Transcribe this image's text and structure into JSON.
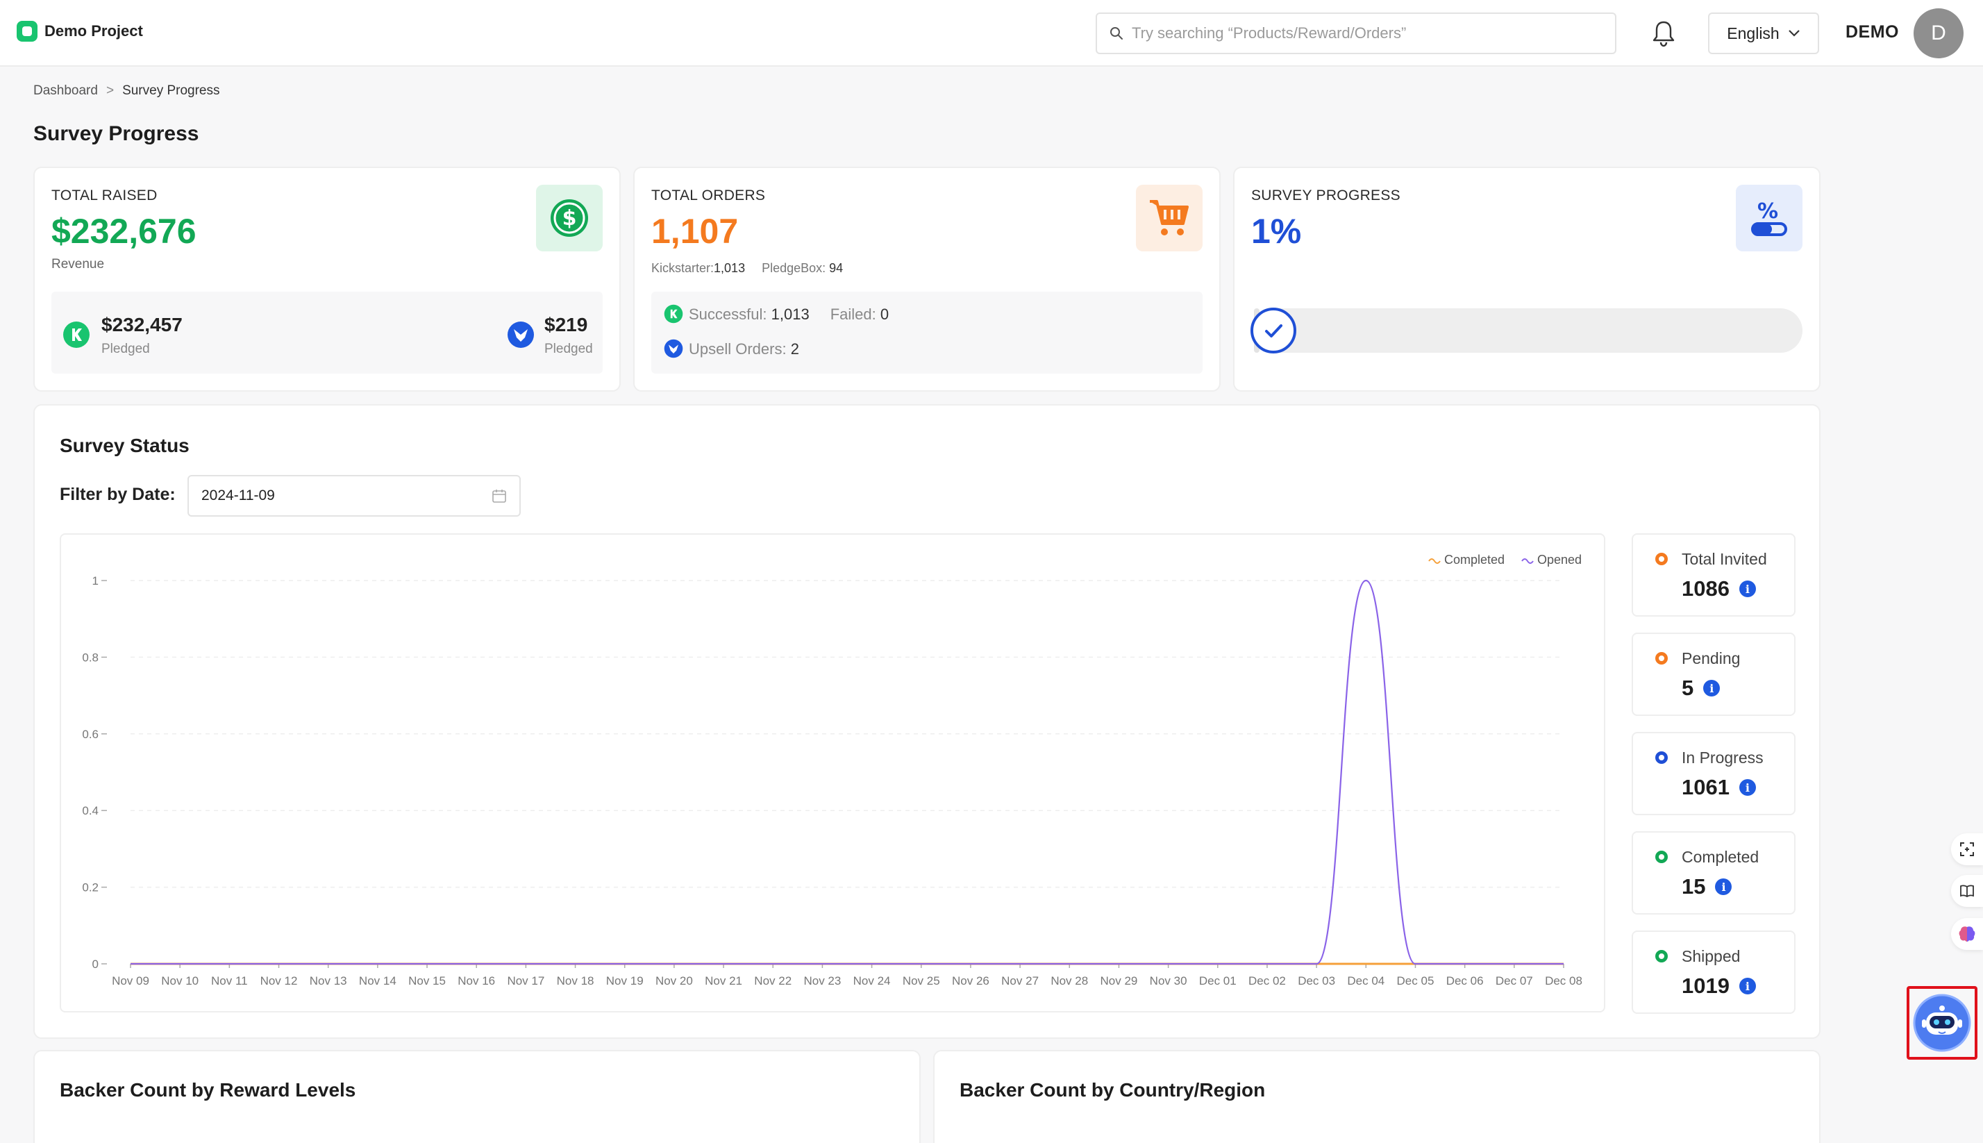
{
  "app": {
    "name": "Demo Project"
  },
  "header": {
    "search_placeholder": "Try searching “Products/Reward/Orders”",
    "language": "English",
    "user_name": "DEMO",
    "avatar_letter": "D"
  },
  "breadcrumb": {
    "home": "Dashboard",
    "separator": ">",
    "current": "Survey Progress"
  },
  "page_title": "Survey Progress",
  "cards": {
    "raised": {
      "label": "TOTAL RAISED",
      "value": "$232,676",
      "sub": "Revenue",
      "kickstarter_amount": "$232,457",
      "kickstarter_label": "Pledged",
      "pledgebox_amount": "$219",
      "pledgebox_label": "Pledged",
      "accent": "#12a855"
    },
    "orders": {
      "label": "TOTAL ORDERS",
      "value": "1,107",
      "kickstarter_label": "Kickstarter:",
      "kickstarter_value": "1,013",
      "pledgebox_label": "PledgeBox:",
      "pledgebox_value": "94",
      "successful_label": "Successful:",
      "successful_value": "1,013",
      "failed_label": "Failed:",
      "failed_value": "0",
      "upsell_label": "Upsell Orders:",
      "upsell_value": "2",
      "accent": "#f47a1f"
    },
    "progress": {
      "label": "SURVEY PROGRESS",
      "value": "1%",
      "fraction": 0.01,
      "accent": "#1f4fd6"
    }
  },
  "survey_status": {
    "title": "Survey Status",
    "filter_label": "Filter by Date:",
    "date_value": "2024-11-09",
    "stats": [
      {
        "label": "Total Invited",
        "value": "1086",
        "color": "#f47a1f"
      },
      {
        "label": "Pending",
        "value": "5",
        "color": "#f47a1f"
      },
      {
        "label": "In Progress",
        "value": "1061",
        "color": "#1f4fd6"
      },
      {
        "label": "Completed",
        "value": "15",
        "color": "#12a855"
      },
      {
        "label": "Shipped",
        "value": "1019",
        "color": "#12a855"
      }
    ]
  },
  "chart_data": {
    "type": "line",
    "legend_position": "top-right",
    "grid": true,
    "ylim": [
      0,
      1
    ],
    "y_ticks": [
      "0",
      "0.2",
      "0.4",
      "0.6",
      "0.8",
      "1"
    ],
    "x": [
      "Nov 09",
      "Nov 10",
      "Nov 11",
      "Nov 12",
      "Nov 13",
      "Nov 14",
      "Nov 15",
      "Nov 16",
      "Nov 17",
      "Nov 18",
      "Nov 19",
      "Nov 20",
      "Nov 21",
      "Nov 22",
      "Nov 23",
      "Nov 24",
      "Nov 25",
      "Nov 26",
      "Nov 27",
      "Nov 28",
      "Nov 29",
      "Nov 30",
      "Dec 01",
      "Dec 02",
      "Dec 03",
      "Dec 04",
      "Dec 05",
      "Dec 06",
      "Dec 07",
      "Dec 08"
    ],
    "series": [
      {
        "name": "Completed",
        "color": "#f5a03a",
        "values": [
          0,
          0,
          0,
          0,
          0,
          0,
          0,
          0,
          0,
          0,
          0,
          0,
          0,
          0,
          0,
          0,
          0,
          0,
          0,
          0,
          0,
          0,
          0,
          0,
          0,
          0,
          0,
          0,
          0,
          0
        ]
      },
      {
        "name": "Opened",
        "color": "#8a63e8",
        "values": [
          0,
          0,
          0,
          0,
          0,
          0,
          0,
          0,
          0,
          0,
          0,
          0,
          0,
          0,
          0,
          0,
          0,
          0,
          0,
          0,
          0,
          0,
          0,
          0,
          0,
          1,
          0,
          0,
          0,
          0
        ]
      }
    ]
  },
  "sections": {
    "reward_levels": "Backer Count by Reward Levels",
    "country": "Backer Count by Country/Region"
  },
  "icons": {
    "dollar": "dollar-icon",
    "cart": "cart-icon",
    "percent": "percent-icon",
    "bell": "bell-icon",
    "search": "search-icon",
    "calendar": "calendar-icon",
    "assistant": "robot-assistant-icon"
  }
}
